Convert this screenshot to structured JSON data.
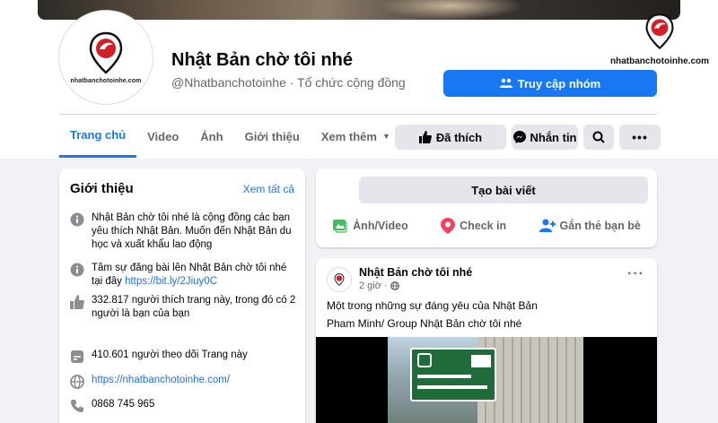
{
  "page": {
    "name": "Nhật Bản chờ tôi nhé",
    "handle_category": "@Nhatbanchotoinhe · Tổ chức cộng đồng",
    "avatar_site": "nhatbanchotoinhe.com",
    "watermark_site": "nhatbanchotoinhe.com",
    "group_button": "Truy cập nhóm"
  },
  "nav": {
    "tabs": [
      {
        "label": "Trang chủ",
        "active": true
      },
      {
        "label": "Video"
      },
      {
        "label": "Ảnh"
      },
      {
        "label": "Giới thiệu"
      },
      {
        "label": "Xem thêm"
      }
    ],
    "liked_label": "Đã thích",
    "message_label": "Nhắn tin"
  },
  "intro": {
    "title": "Giới thiệu",
    "see_all": "Xem tất cả",
    "description": "Nhật Bản chờ tôi nhé là cộng đồng các bạn yêu thích Nhật Bản. Muốn đến Nhật Bản du học và xuất khẩu lao động",
    "share_text": "Tâm sự đăng bài lên Nhật Bản chờ tôi nhé tại đây",
    "share_link": "https://bit.ly/2Jiuy0C",
    "likes": "332.817 người thích trang này, trong đó có 2 người là bạn của bạn",
    "followers": "410.601 người theo dõi Trang này",
    "website": "https://nhatbanchotoinhe.com/",
    "phone": "0868 745 965"
  },
  "composer": {
    "create_label": "Tạo bài viết",
    "photo_label": "Ảnh/Video",
    "checkin_label": "Check in",
    "tag_label": "Gắn thẻ bạn bè"
  },
  "post": {
    "author": "Nhật Bản chờ tôi nhé",
    "time": "2 giờ ·",
    "line1": "Một trong những sự đáng yêu của Nhật Bản",
    "line2": "Pham Minh/ Group Nhật Bản chờ tôi nhé"
  },
  "colors": {
    "accent": "#1877f2",
    "background": "#f0f2f5",
    "button_gray": "#e4e6eb",
    "brand_red": "#d41f26"
  }
}
